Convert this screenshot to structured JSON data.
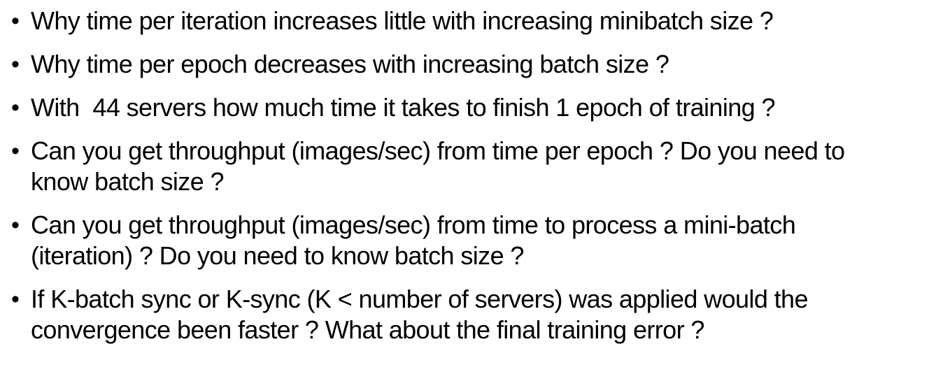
{
  "slide": {
    "bullet_symbol": "•",
    "items": [
      {
        "text": "Why time per iteration increases little with increasing minibatch size ?"
      },
      {
        "text": "Why time per epoch decreases with increasing batch size ?"
      },
      {
        "text": "With  44 servers how much time it takes to finish 1 epoch of training ?"
      },
      {
        "text": "Can you get throughput (images/sec) from time per epoch ?  Do you need to know batch size ?"
      },
      {
        "text": " Can you get throughput (images/sec) from time to process a mini-batch (iteration) ?  Do you need to know batch size ?"
      },
      {
        "text": "If  K-batch sync or K-sync (K < number of servers) was applied would the convergence been faster ? What about the final training error ?"
      }
    ]
  }
}
